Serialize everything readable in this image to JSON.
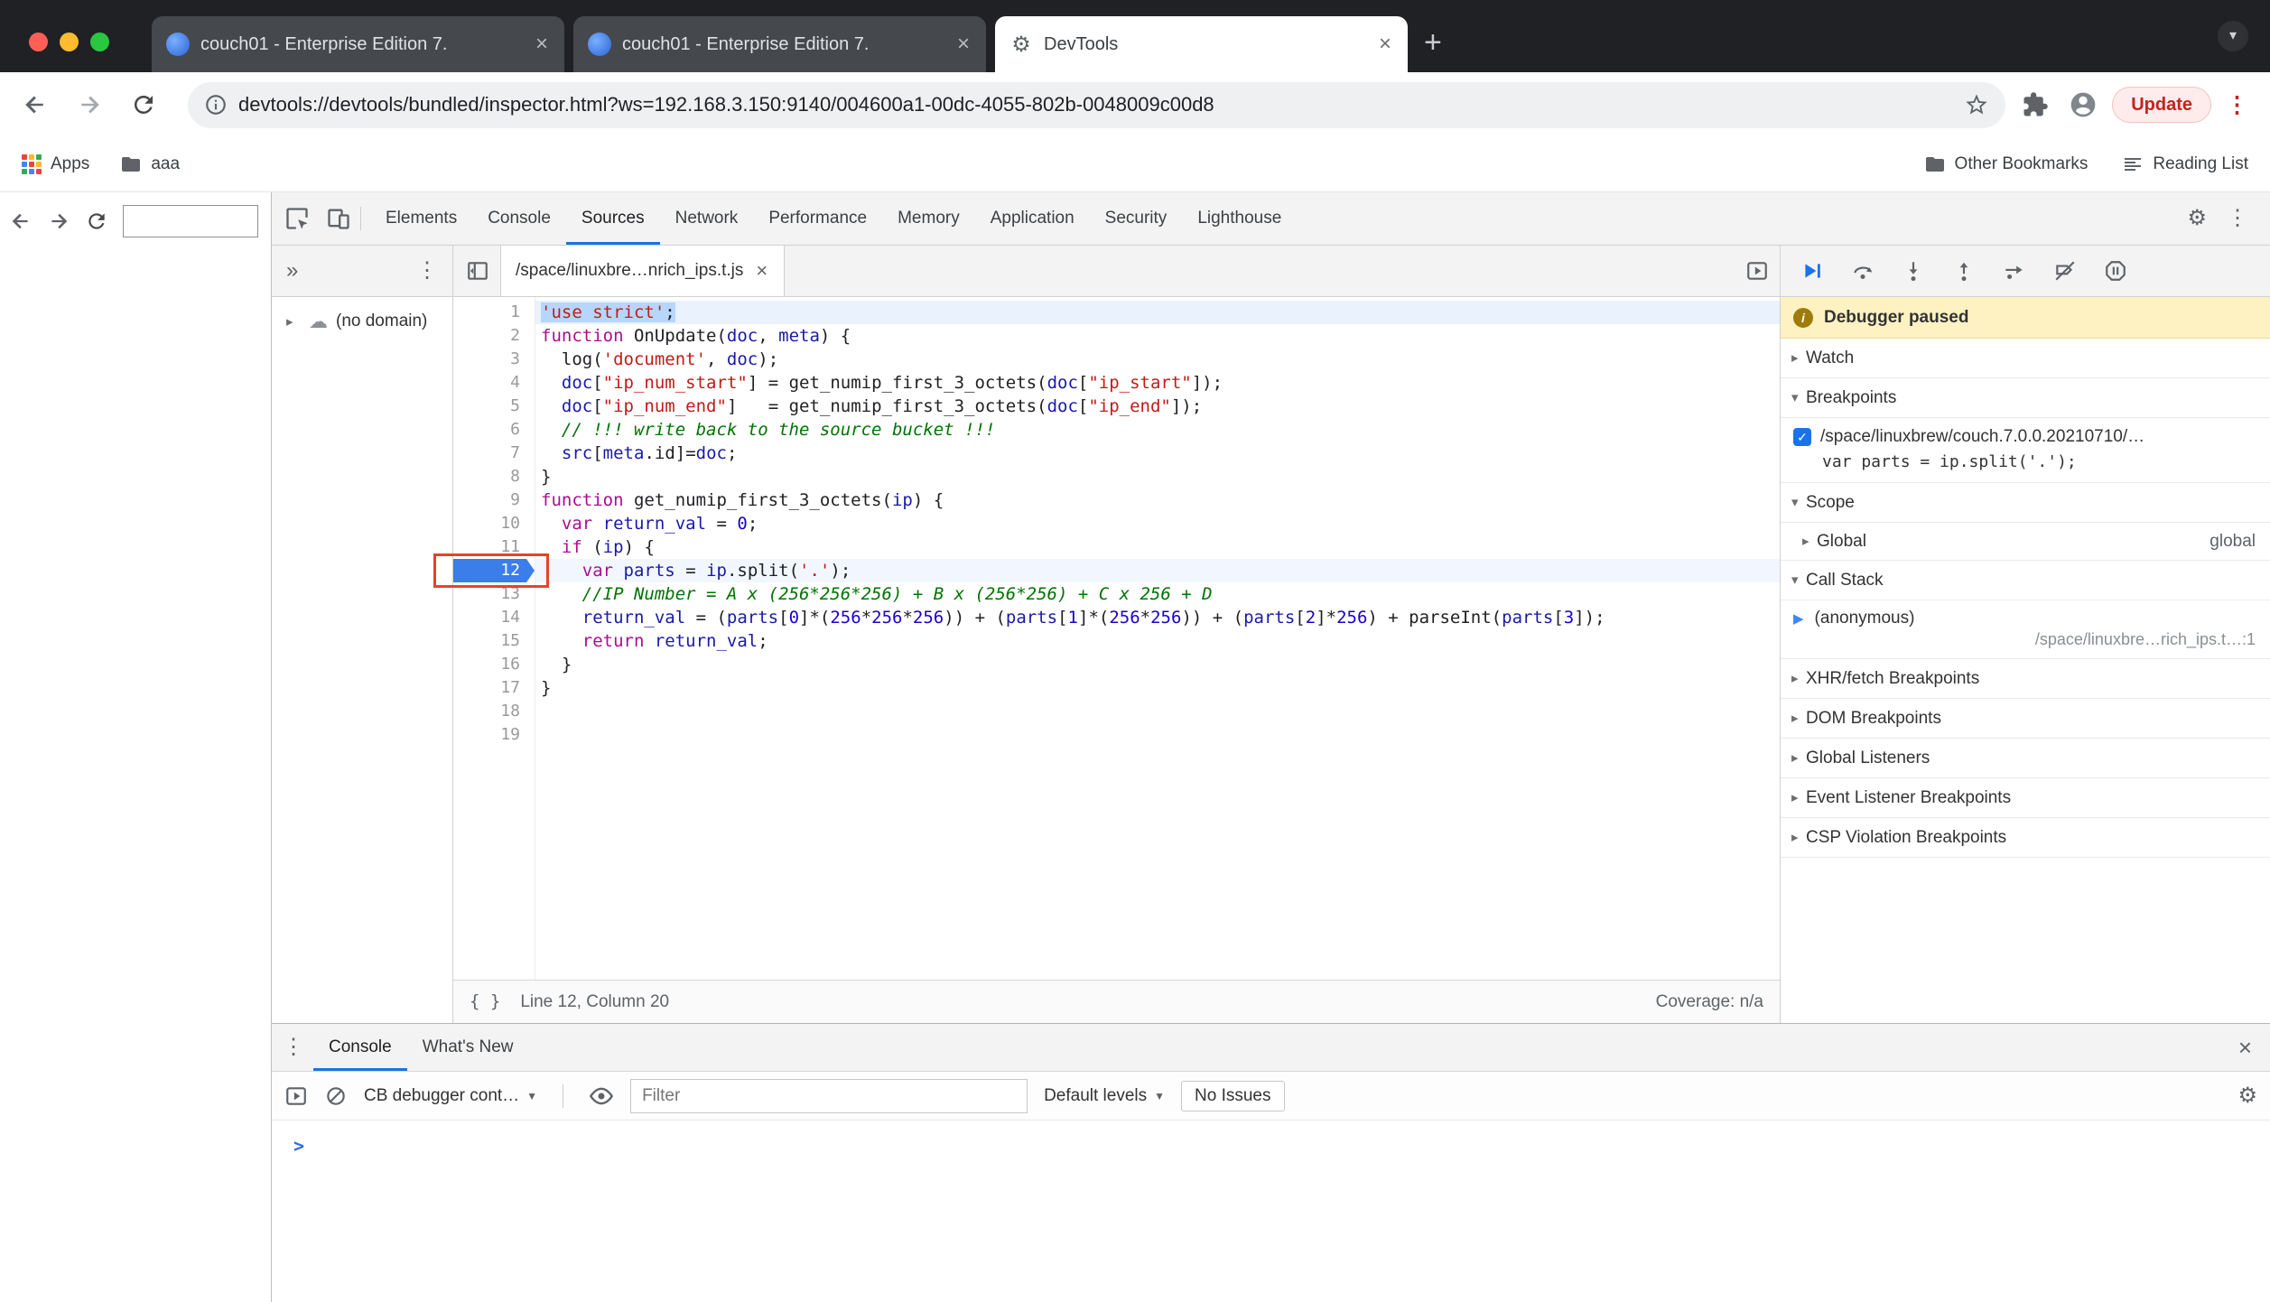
{
  "glyphs": {
    "kebab": "⋮",
    "double_chevron": "»",
    "chevron_down": "▾",
    "close": "×",
    "gear": "⚙",
    "cloud": "☁",
    "plus": "+",
    "prompt": ">",
    "braces": "{ }",
    "tri_collapsed": "▸",
    "tri_expanded": "▾",
    "check": "✓",
    "dropdown": "▼",
    "info": "i",
    "frame_arrow": "▶"
  },
  "colors": {
    "accent": "#1a73e8",
    "exec_line_badge": "#3b7de9",
    "paused_banner": "#fff2c2",
    "annotation": "#e4442a",
    "update_red": "#c5221f",
    "string": "#c41a16",
    "keyword": "#aa0d91",
    "number": "#1c00cf",
    "comment": "#007400",
    "variable": "#1a1aa6"
  },
  "window": {
    "tabs": [
      {
        "title": "couch01 - Enterprise Edition 7.",
        "favicon": "couchbase",
        "active": false
      },
      {
        "title": "couch01 - Enterprise Edition 7.",
        "favicon": "couchbase",
        "active": false
      },
      {
        "title": "DevTools",
        "favicon": "devtools",
        "active": true
      }
    ],
    "url": "devtools://devtools/bundled/inspector.html?ws=192.168.3.150:9140/004600a1-00dc-4055-802b-0048009c00d8",
    "update_label": "Update",
    "bookmarks": {
      "apps_label": "Apps",
      "folder_label": "aaa",
      "other_label": "Other Bookmarks",
      "reading_label": "Reading List"
    }
  },
  "devtools": {
    "tabs": [
      "Elements",
      "Console",
      "Sources",
      "Network",
      "Performance",
      "Memory",
      "Application",
      "Security",
      "Lighthouse"
    ],
    "active_tab": "Sources",
    "navigator": {
      "no_domain": "(no domain)"
    },
    "file_tab": "/space/linuxbre…nrich_ips.t.js",
    "status": {
      "line_col": "Line 12, Column 20",
      "coverage": "Coverage: n/a"
    },
    "sidebar": {
      "paused": "Debugger paused",
      "sections": [
        {
          "label": "Watch",
          "expanded": false
        },
        {
          "label": "Breakpoints",
          "expanded": true,
          "key": "breakpoints"
        },
        {
          "label": "Scope",
          "expanded": true,
          "key": "scope"
        },
        {
          "label": "Call Stack",
          "expanded": true,
          "key": "callstack"
        },
        {
          "label": "XHR/fetch Breakpoints",
          "expanded": false
        },
        {
          "label": "DOM Breakpoints",
          "expanded": false
        },
        {
          "label": "Global Listeners",
          "expanded": false
        },
        {
          "label": "Event Listener Breakpoints",
          "expanded": false
        },
        {
          "label": "CSP Violation Breakpoints",
          "expanded": false
        }
      ],
      "breakpoint_file": "/space/linuxbrew/couch.7.0.0.20210710/…",
      "breakpoint_code": "var parts = ip.split('.');",
      "scope_item": "Global",
      "scope_value": "global",
      "frame_name": "(anonymous)",
      "frame_location": "/space/linuxbre…rich_ips.t…:1"
    },
    "console": {
      "tabs": [
        "Console",
        "What's New"
      ],
      "active_tab": "Console",
      "context": "CB debugger cont…",
      "filter_placeholder": "Filter",
      "levels": "Default levels",
      "no_issues": "No Issues",
      "prompt": ">"
    },
    "code": {
      "current_line": 12,
      "annotation_line": 12,
      "lines": [
        {
          "hl": "line-sel",
          "t": [
            [
              "s sel",
              "'use strict'"
            ],
            [
              "p sel",
              ";"
            ]
          ]
        },
        {
          "t": [
            [
              "k",
              "function"
            ],
            [
              "p",
              " OnUpdate("
            ],
            [
              "v",
              "doc"
            ],
            [
              "p",
              ", "
            ],
            [
              "v",
              "meta"
            ],
            [
              "p",
              ") {"
            ]
          ]
        },
        {
          "t": [
            [
              "p",
              "  log("
            ],
            [
              "s",
              "'document'"
            ],
            [
              "p",
              ", "
            ],
            [
              "v",
              "doc"
            ],
            [
              "p",
              ");"
            ]
          ]
        },
        {
          "t": [
            [
              "p",
              "  "
            ],
            [
              "v",
              "doc"
            ],
            [
              "p",
              "["
            ],
            [
              "s",
              "\"ip_num_start\""
            ],
            [
              "p",
              "] = get_numip_first_3_octets("
            ],
            [
              "v",
              "doc"
            ],
            [
              "p",
              "["
            ],
            [
              "s",
              "\"ip_start\""
            ],
            [
              "p",
              "]);"
            ]
          ]
        },
        {
          "t": [
            [
              "p",
              "  "
            ],
            [
              "v",
              "doc"
            ],
            [
              "p",
              "["
            ],
            [
              "s",
              "\"ip_num_end\""
            ],
            [
              "p",
              "]   = get_numip_first_3_octets("
            ],
            [
              "v",
              "doc"
            ],
            [
              "p",
              "["
            ],
            [
              "s",
              "\"ip_end\""
            ],
            [
              "p",
              "]);"
            ]
          ]
        },
        {
          "t": [
            [
              "p",
              "  "
            ],
            [
              "c",
              "// !!! write back to the source bucket !!!"
            ]
          ]
        },
        {
          "t": [
            [
              "p",
              "  "
            ],
            [
              "v",
              "src"
            ],
            [
              "p",
              "["
            ],
            [
              "v",
              "meta"
            ],
            [
              "p",
              ".id]="
            ],
            [
              "v",
              "doc"
            ],
            [
              "p",
              ";"
            ]
          ]
        },
        {
          "t": [
            [
              "p",
              "}"
            ]
          ]
        },
        {
          "t": [
            [
              "k",
              "function"
            ],
            [
              "p",
              " get_numip_first_3_octets("
            ],
            [
              "v",
              "ip"
            ],
            [
              "p",
              ") {"
            ]
          ]
        },
        {
          "t": [
            [
              "p",
              "  "
            ],
            [
              "k",
              "var"
            ],
            [
              "p",
              " "
            ],
            [
              "v",
              "return_val"
            ],
            [
              "p",
              " = "
            ],
            [
              "n",
              "0"
            ],
            [
              "p",
              ";"
            ]
          ]
        },
        {
          "t": [
            [
              "p",
              "  "
            ],
            [
              "k",
              "if"
            ],
            [
              "p",
              " ("
            ],
            [
              "v",
              "ip"
            ],
            [
              "p",
              ") {"
            ]
          ]
        },
        {
          "hl": "exec-line",
          "t": [
            [
              "p",
              "    "
            ],
            [
              "k",
              "var"
            ],
            [
              "p",
              " "
            ],
            [
              "v",
              "parts"
            ],
            [
              "p",
              " = "
            ],
            [
              "v",
              "ip"
            ],
            [
              "p",
              ".split("
            ],
            [
              "s",
              "'.'"
            ],
            [
              "p",
              ");"
            ]
          ]
        },
        {
          "t": [
            [
              "p",
              "    "
            ],
            [
              "c",
              "//IP Number = A x (256*256*256) + B x (256*256) + C x 256 + D"
            ]
          ]
        },
        {
          "t": [
            [
              "p",
              "    "
            ],
            [
              "v",
              "return_val"
            ],
            [
              "p",
              " = ("
            ],
            [
              "v",
              "parts"
            ],
            [
              "p",
              "["
            ],
            [
              "n",
              "0"
            ],
            [
              "p",
              "]*("
            ],
            [
              "n",
              "256"
            ],
            [
              "p",
              "*"
            ],
            [
              "n",
              "256"
            ],
            [
              "p",
              "*"
            ],
            [
              "n",
              "256"
            ],
            [
              "p",
              ")) + ("
            ],
            [
              "v",
              "parts"
            ],
            [
              "p",
              "["
            ],
            [
              "n",
              "1"
            ],
            [
              "p",
              "]*("
            ],
            [
              "n",
              "256"
            ],
            [
              "p",
              "*"
            ],
            [
              "n",
              "256"
            ],
            [
              "p",
              ")) + ("
            ],
            [
              "v",
              "parts"
            ],
            [
              "p",
              "["
            ],
            [
              "n",
              "2"
            ],
            [
              "p",
              "]*"
            ],
            [
              "n",
              "256"
            ],
            [
              "p",
              ") + parseInt("
            ],
            [
              "v",
              "parts"
            ],
            [
              "p",
              "["
            ],
            [
              "n",
              "3"
            ],
            [
              "p",
              "]);"
            ]
          ]
        },
        {
          "t": [
            [
              "p",
              "    "
            ],
            [
              "k",
              "return"
            ],
            [
              "p",
              " "
            ],
            [
              "v",
              "return_val"
            ],
            [
              "p",
              ";"
            ]
          ]
        },
        {
          "t": [
            [
              "p",
              "  }"
            ]
          ]
        },
        {
          "t": [
            [
              "p",
              "}"
            ]
          ]
        },
        {
          "t": []
        },
        {
          "t": []
        }
      ]
    }
  }
}
